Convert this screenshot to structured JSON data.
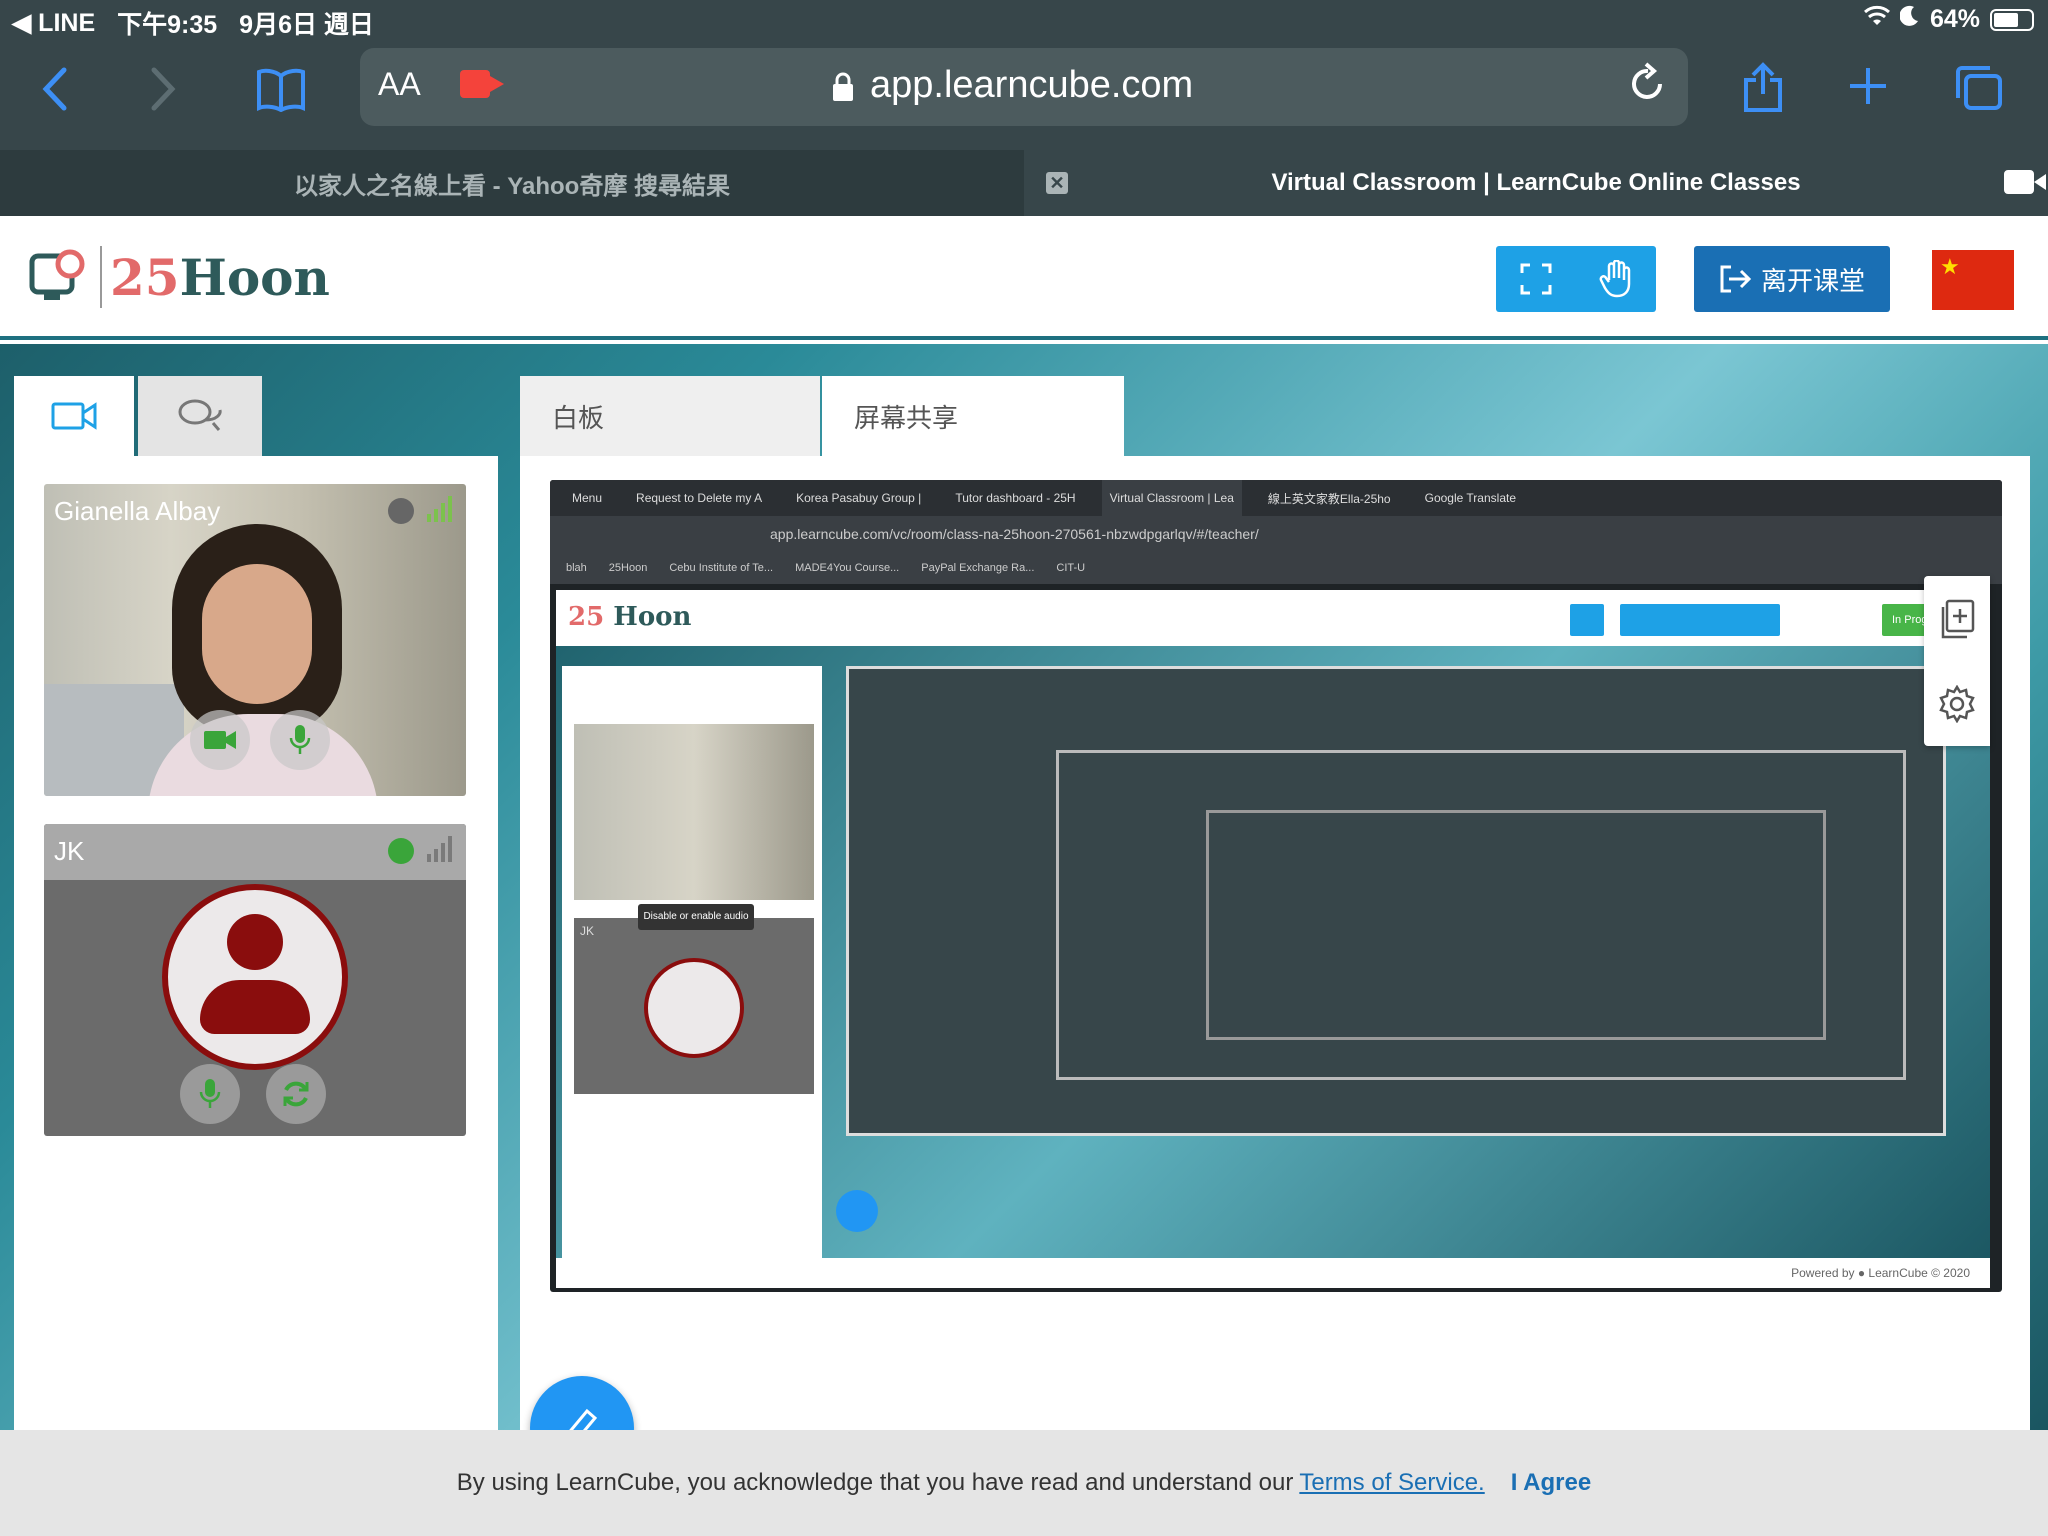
{
  "status_bar": {
    "back_app": "◀ LINE",
    "time": "下午9:35",
    "date": "9月6日 週日",
    "battery": "64%",
    "battery_level": 0.64
  },
  "safari": {
    "text_size": "AA",
    "url": "app.learncube.com",
    "icons": [
      "back-icon",
      "forward-icon",
      "bookmarks-icon",
      "text-size-icon",
      "recording-icon",
      "lock-icon",
      "reload-icon",
      "share-icon",
      "new-tab-icon",
      "tabs-icon"
    ]
  },
  "tabs": {
    "tab1": "以家人之名線上看 - Yahoo奇摩 搜尋結果",
    "tab2": "Virtual Classroom | LearnCube Online Classes"
  },
  "header": {
    "logo_num": "25",
    "logo_word": "Hoon",
    "leave_label": "离开课堂",
    "flag": "china-flag",
    "colors": {
      "primary": "#1ea1e6",
      "leave": "#1a6fb4",
      "accent": "#e26a6a"
    }
  },
  "left_panel": {
    "participants": [
      {
        "name": "Gianella Albay",
        "status_color": "#666666"
      },
      {
        "name": "JK",
        "status_color": "#3aa53a"
      }
    ]
  },
  "right_panel": {
    "tabs": [
      {
        "label": "白板"
      },
      {
        "label": "屏幕共享"
      }
    ],
    "shared_screen": {
      "browser_tabs": [
        "Menu",
        "Request to Delete my A",
        "Korea Pasabuy Group |",
        "Tutor dashboard - 25H",
        "Virtual Classroom | Lea",
        "線上英文家教Ella-25ho",
        "Google Translate"
      ],
      "url": "app.learncube.com/vc/room/class-na-25hoon-270561-nbzwdpgarlqv/#/teacher/",
      "bookmarks": [
        "blah",
        "25Hoon",
        "Cebu Institute of Te...",
        "MADE4You Course...",
        "PayPal Exchange Ra...",
        "CIT-U"
      ],
      "status": "In Progress",
      "tooltip": "Disable or enable audio",
      "participant": "JK",
      "footer": "Powered by ● LearnCube © 2020"
    }
  },
  "consent": {
    "text": "By using LearnCube, you acknowledge that you have read and understand our",
    "link": "Terms of Service.",
    "agree": "I Agree"
  }
}
